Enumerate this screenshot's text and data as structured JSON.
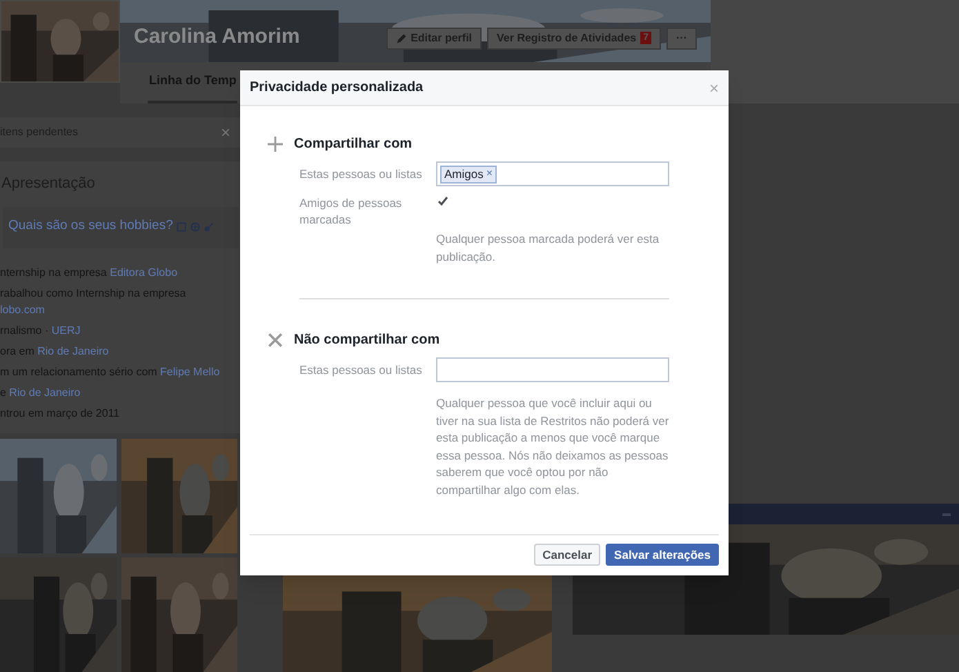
{
  "profile": {
    "name": "Carolina Amorim",
    "buttons": [
      {
        "label": "Editar perfil",
        "kind": "edit"
      },
      {
        "label": "Ver Registro de Atividades",
        "kind": "activity",
        "badge": "7"
      },
      {
        "label": "···",
        "kind": "more"
      }
    ]
  },
  "tabs": [
    {
      "label": "Linha do Temp",
      "selected": true
    }
  ],
  "pending": {
    "text": "itens pendentes",
    "close": "×"
  },
  "intro": {
    "title": "Apresentação",
    "hobbies_prompt": "Quais são os seus hobbies?",
    "items": [
      {
        "text": "nternship na empresa ",
        "link": "Editora Globo"
      },
      {
        "text": "rabalhou como Internship na empresa ",
        "link": "lobo.com"
      },
      {
        "text": "rnalismo · ",
        "link": "UERJ"
      },
      {
        "text": "ora em ",
        "link": "Rio de Janeiro"
      },
      {
        "text": "m um relacionamento sério com ",
        "link": "Felipe Mello"
      },
      {
        "text": "e ",
        "link": "Rio de Janeiro"
      },
      {
        "text": "ntrou em março de 2011"
      }
    ]
  },
  "dialog": {
    "title": "Privacidade personalizada",
    "close": "×",
    "sections": [
      {
        "kind": "share",
        "heading": "Compartilhar com",
        "field_label": "Estas pessoas ou listas",
        "tokens": [
          {
            "label": "Amigos",
            "remove": "×"
          }
        ],
        "checkbox": {
          "label": "Amigos de pessoas marcadas",
          "checked": true
        },
        "help": "Qualquer pessoa marcada poderá ver esta publicação."
      },
      {
        "kind": "exclude",
        "heading": "Não compartilhar com",
        "field_label": "Estas pessoas ou listas",
        "help": "Qualquer pessoa que você incluir aqui ou tiver na sua lista de Restritos não poderá ver esta publicação a menos que você marque essa pessoa. Nós não deixamos as pessoas saberem que você optou por não compartilhar algo com elas."
      }
    ],
    "buttons": [
      {
        "label": "Cancelar",
        "kind": "secondary"
      },
      {
        "label": "Salvar alterações",
        "kind": "primary"
      }
    ]
  }
}
